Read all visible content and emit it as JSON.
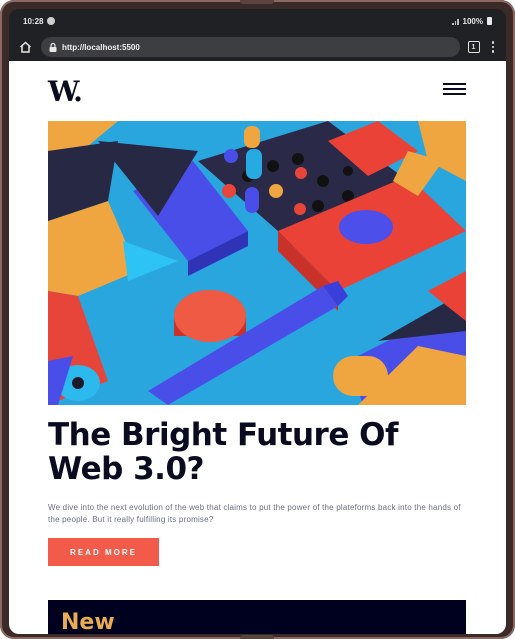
{
  "status_bar": {
    "time": "10:28",
    "battery": "100%"
  },
  "browser": {
    "url": "http://localhost:5500",
    "tab_count": "1"
  },
  "header": {
    "logo": "W."
  },
  "article": {
    "title": "The Bright Future Of Web 3.0?",
    "summary": "We dive into the next evolution of the web that claims to put the power of the plateforms back into the hands of the people. But it really fulfilling its promise?",
    "cta_label": "READ MORE"
  },
  "new_section": {
    "title": "New"
  },
  "colors": {
    "accent": "#f25a4a",
    "navy": "#00011f",
    "gold": "#e9ab53"
  }
}
